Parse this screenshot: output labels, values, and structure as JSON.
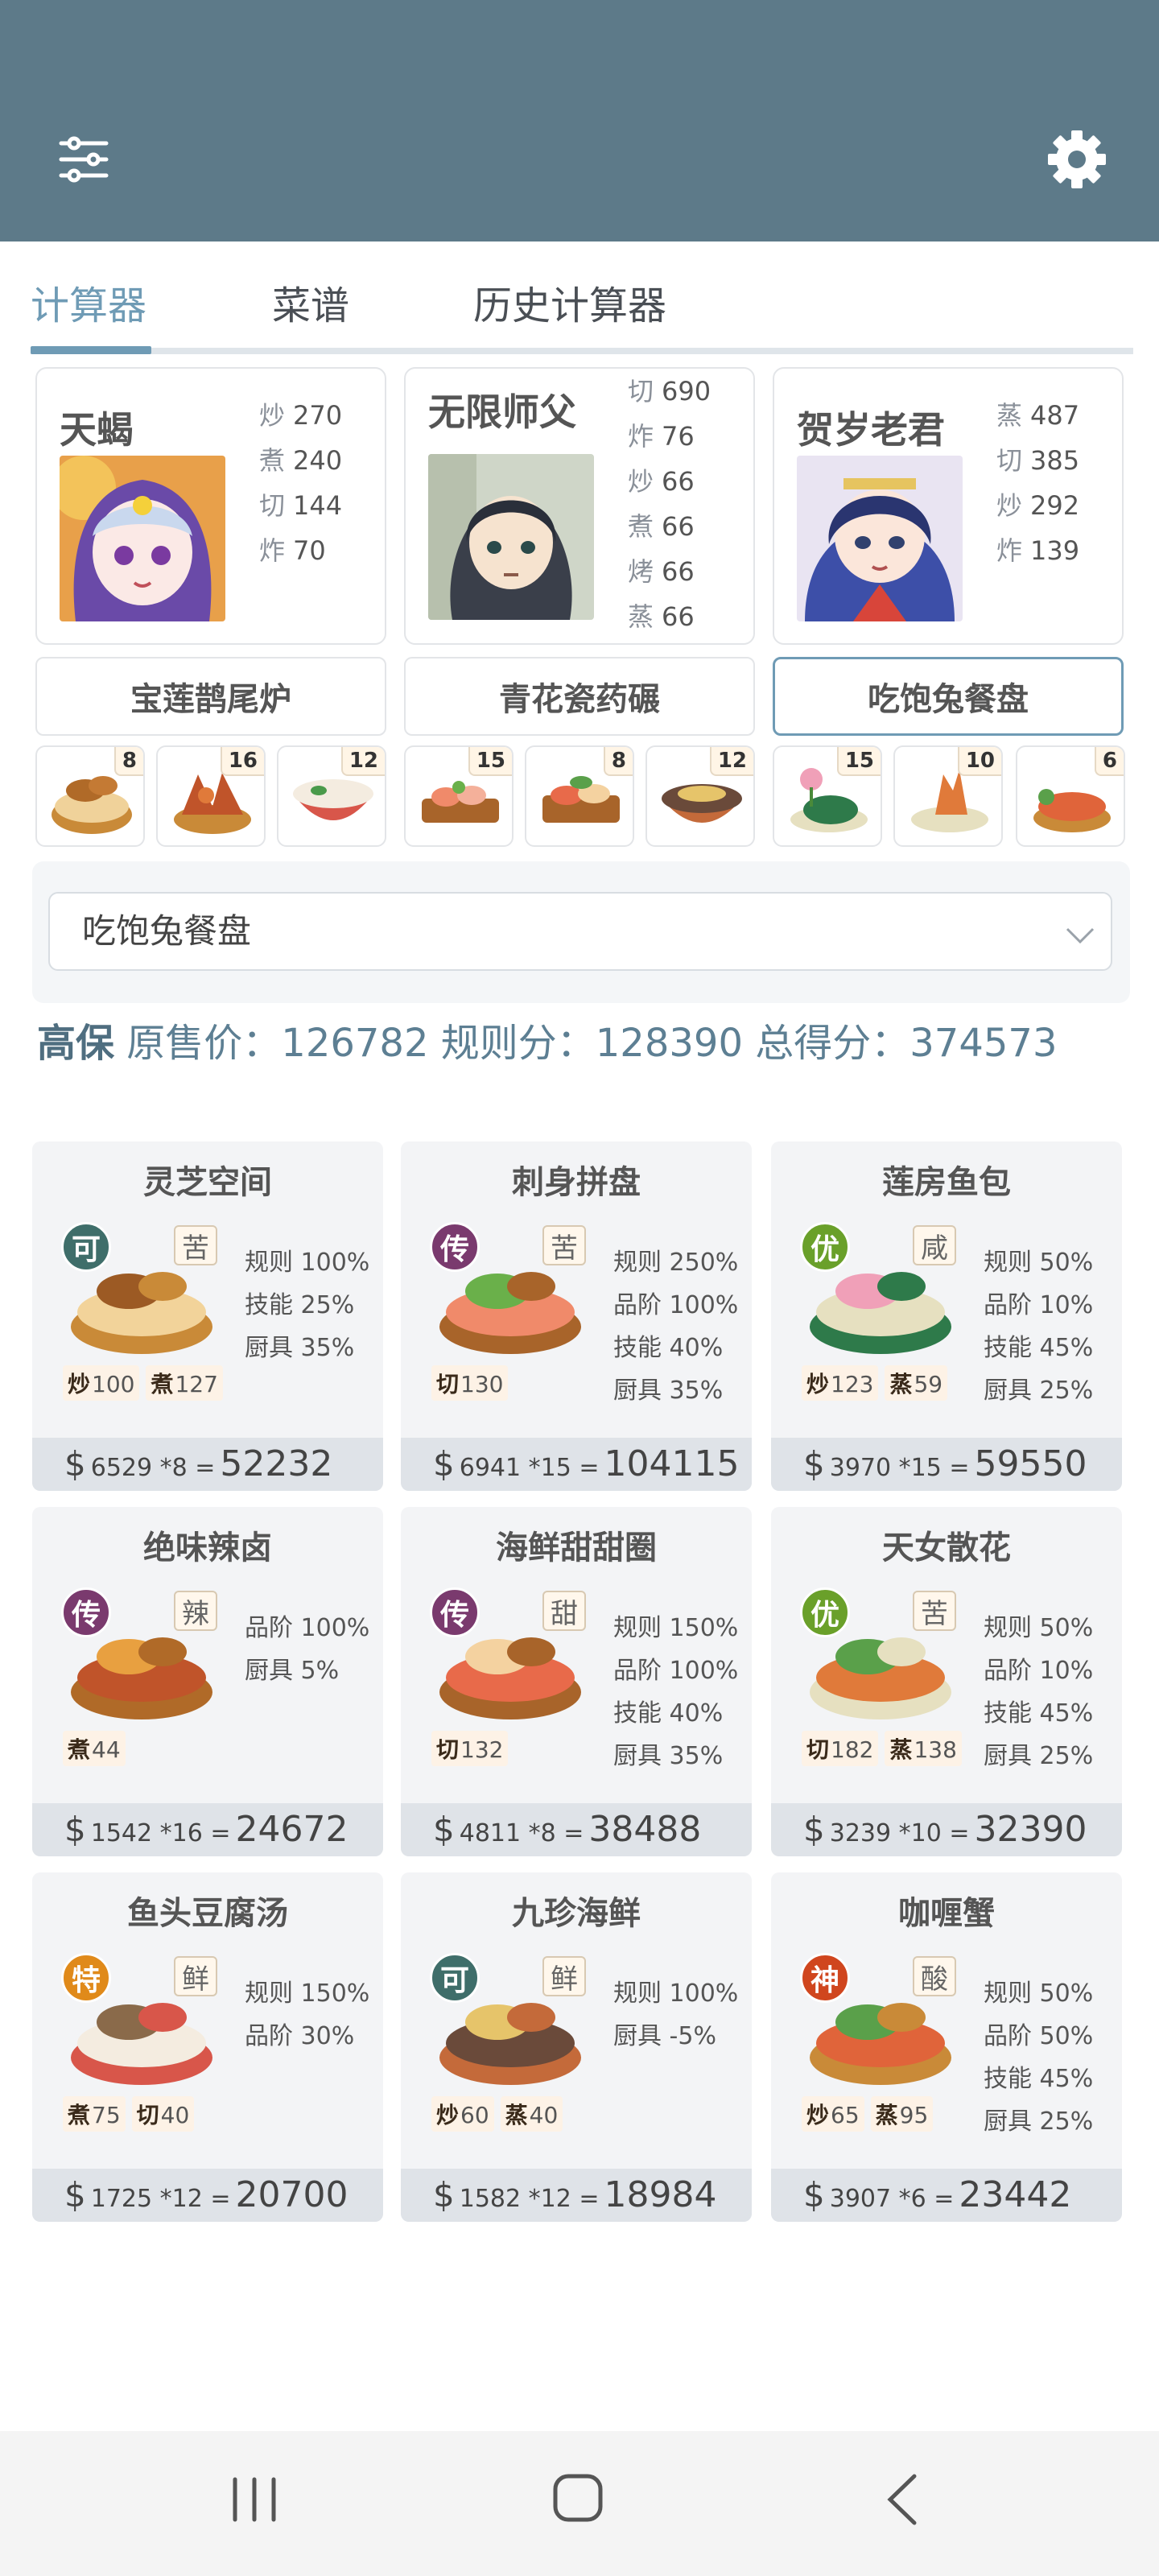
{
  "tabs": [
    {
      "label": "计算器"
    },
    {
      "label": "菜谱"
    },
    {
      "label": "历史计算器"
    }
  ],
  "chefs": [
    {
      "name": "天蝎",
      "skills": [
        {
          "k": "炒",
          "v": "270"
        },
        {
          "k": "煮",
          "v": "240"
        },
        {
          "k": "切",
          "v": "144"
        },
        {
          "k": "炸",
          "v": "70"
        }
      ]
    },
    {
      "name": "无限师父",
      "skills": [
        {
          "k": "切",
          "v": "690"
        },
        {
          "k": "炸",
          "v": "76"
        },
        {
          "k": "炒",
          "v": "66"
        },
        {
          "k": "煮",
          "v": "66"
        },
        {
          "k": "烤",
          "v": "66"
        },
        {
          "k": "蒸",
          "v": "66"
        }
      ]
    },
    {
      "name": "贺岁老君",
      "skills": [
        {
          "k": "蒸",
          "v": "487"
        },
        {
          "k": "切",
          "v": "385"
        },
        {
          "k": "炒",
          "v": "292"
        },
        {
          "k": "炸",
          "v": "139"
        }
      ]
    }
  ],
  "equips": [
    {
      "label": "宝莲鹊尾炉"
    },
    {
      "label": "青花瓷药碾"
    },
    {
      "label": "吃饱兔餐盘"
    }
  ],
  "mini_dishes": [
    {
      "count": "8"
    },
    {
      "count": "16"
    },
    {
      "count": "12"
    },
    {
      "count": "15"
    },
    {
      "count": "8"
    },
    {
      "count": "12"
    },
    {
      "count": "15"
    },
    {
      "count": "10"
    },
    {
      "count": "6"
    }
  ],
  "select": {
    "value": "吃饱兔餐盘"
  },
  "summary": {
    "grade": "高保",
    "text": " 原售价：126782 规则分：128390 总得分：374573"
  },
  "dishes": [
    {
      "name": "灵芝空间",
      "rarity": "可",
      "rarity_color": "#3f6e6a",
      "flavor": "苦",
      "bonus": [
        "规则 100%",
        "技能 25%",
        "厨具 35%"
      ],
      "req": [
        {
          "k": "炒",
          "v": "100"
        },
        {
          "k": "煮",
          "v": "127"
        }
      ],
      "price": "6529",
      "mult": "*8",
      "total": "52232"
    },
    {
      "name": "刺身拼盘",
      "rarity": "传",
      "rarity_color": "#7a3a6e",
      "flavor": "苦",
      "bonus": [
        "规则 250%",
        "品阶 100%",
        "技能 40%",
        "厨具 35%"
      ],
      "req": [
        {
          "k": "切",
          "v": "130"
        }
      ],
      "price": "6941",
      "mult": "*15",
      "total": "104115"
    },
    {
      "name": "莲房鱼包",
      "rarity": "优",
      "rarity_color": "#6aa02a",
      "flavor": "咸",
      "bonus": [
        "规则 50%",
        "品阶 10%",
        "技能 45%",
        "厨具 25%"
      ],
      "req": [
        {
          "k": "炒",
          "v": "123"
        },
        {
          "k": "蒸",
          "v": "59"
        }
      ],
      "price": "3970",
      "mult": "*15",
      "total": "59550"
    },
    {
      "name": "绝味辣卤",
      "rarity": "传",
      "rarity_color": "#7a3a6e",
      "flavor": "辣",
      "bonus": [
        "品阶 100%",
        "厨具 5%"
      ],
      "req": [
        {
          "k": "煮",
          "v": "44"
        }
      ],
      "price": "1542",
      "mult": "*16",
      "total": "24672"
    },
    {
      "name": "海鲜甜甜圈",
      "rarity": "传",
      "rarity_color": "#7a3a6e",
      "flavor": "甜",
      "bonus": [
        "规则 150%",
        "品阶 100%",
        "技能 40%",
        "厨具 35%"
      ],
      "req": [
        {
          "k": "切",
          "v": "132"
        }
      ],
      "price": "4811",
      "mult": "*8",
      "total": "38488"
    },
    {
      "name": "天女散花",
      "rarity": "优",
      "rarity_color": "#6aa02a",
      "flavor": "苦",
      "bonus": [
        "规则 50%",
        "品阶 10%",
        "技能 45%",
        "厨具 25%"
      ],
      "req": [
        {
          "k": "切",
          "v": "182"
        },
        {
          "k": "蒸",
          "v": "138"
        }
      ],
      "price": "3239",
      "mult": "*10",
      "total": "32390"
    },
    {
      "name": "鱼头豆腐汤",
      "rarity": "特",
      "rarity_color": "#e08a1a",
      "flavor": "鲜",
      "bonus": [
        "规则 150%",
        "品阶 30%"
      ],
      "req": [
        {
          "k": "煮",
          "v": "75"
        },
        {
          "k": "切",
          "v": "40"
        }
      ],
      "price": "1725",
      "mult": "*12",
      "total": "20700"
    },
    {
      "name": "九珍海鲜",
      "rarity": "可",
      "rarity_color": "#3f6e6a",
      "flavor": "鲜",
      "bonus": [
        "规则 100%",
        "厨具 -5%"
      ],
      "req": [
        {
          "k": "炒",
          "v": "60"
        },
        {
          "k": "蒸",
          "v": "40"
        }
      ],
      "price": "1582",
      "mult": "*12",
      "total": "18984"
    },
    {
      "name": "咖喱蟹",
      "rarity": "神",
      "rarity_color": "#d0461e",
      "flavor": "酸",
      "bonus": [
        "规则 50%",
        "品阶 50%",
        "技能 45%",
        "厨具 25%"
      ],
      "req": [
        {
          "k": "炒",
          "v": "65"
        },
        {
          "k": "蒸",
          "v": "95"
        }
      ],
      "price": "3907",
      "mult": "*6",
      "total": "23442"
    }
  ],
  "colors": {
    "header": "#5d7a89",
    "accent": "#6f9bb5",
    "card": "#f3f4f6",
    "price_bar": "#dfe3e8"
  },
  "icons": {
    "top_left": "sliders-icon",
    "top_right": "gear-icon",
    "nav": [
      "recents-icon",
      "home-icon",
      "back-icon"
    ]
  }
}
